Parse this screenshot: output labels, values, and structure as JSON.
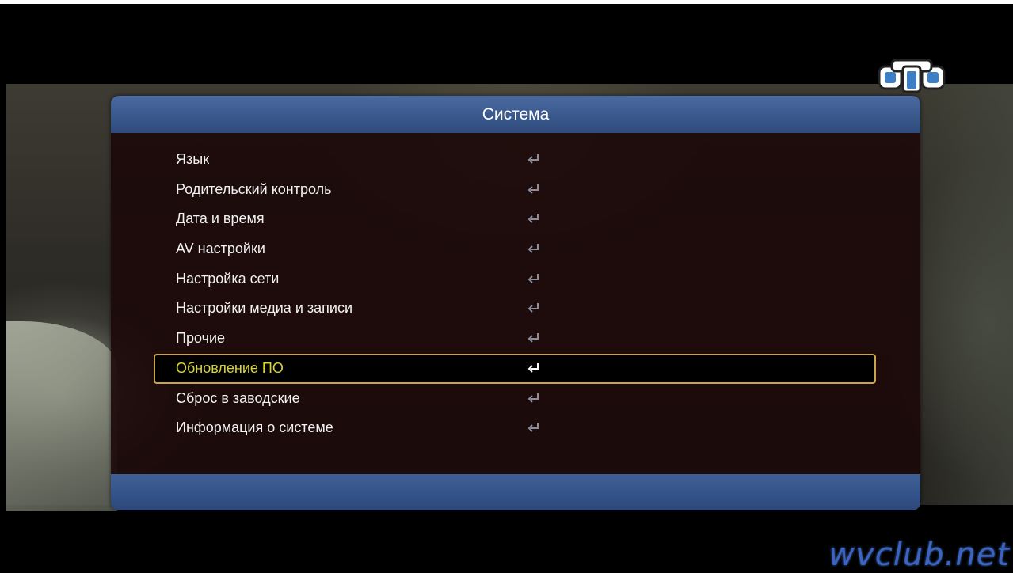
{
  "menu": {
    "title": "Система",
    "selected_index": 7,
    "items": [
      {
        "label": "Язык",
        "icon": "enter-icon"
      },
      {
        "label": "Родительский контроль",
        "icon": "enter-icon"
      },
      {
        "label": "Дата и время",
        "icon": "enter-icon"
      },
      {
        "label": "AV настройки",
        "icon": "enter-icon"
      },
      {
        "label": "Настройка сети",
        "icon": "enter-icon"
      },
      {
        "label": "Настройки медиа и записи",
        "icon": "enter-icon"
      },
      {
        "label": "Прочие",
        "icon": "enter-icon"
      },
      {
        "label": "Обновление ПО",
        "icon": "enter-icon"
      },
      {
        "label": "Сброс в заводские",
        "icon": "enter-icon"
      },
      {
        "label": "Информация о системе",
        "icon": "enter-icon"
      }
    ]
  },
  "channel_logo": {
    "icon": "tv-channel-logo-icon"
  },
  "watermark": {
    "text": "wvclub.net"
  },
  "colors": {
    "header": "#3c5a8e",
    "panel": "#1c0a0a",
    "selected_text": "#d8d430",
    "selected_border": "#c9a44a",
    "watermark": "#3a64c4"
  }
}
